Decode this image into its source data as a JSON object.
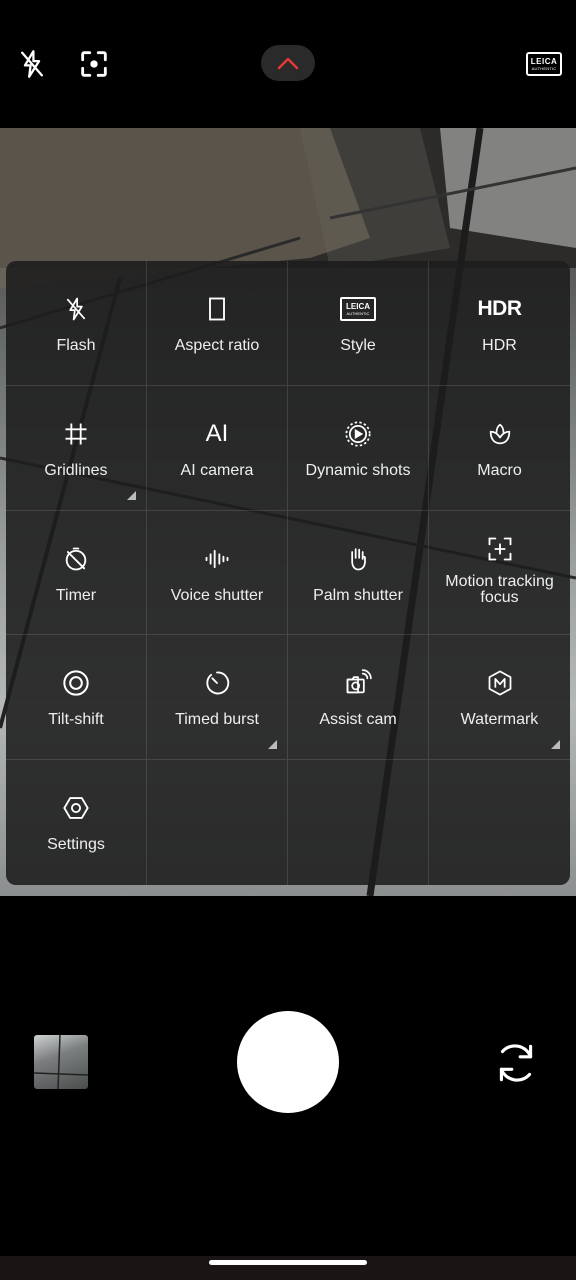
{
  "topbar": {
    "flash_icon": "flash-off-icon",
    "focus_icon": "focus-icon",
    "collapse_icon": "chevron-up-icon",
    "leica_line1": "LEICA",
    "leica_line2": "AUTHENTIC"
  },
  "panel": {
    "items": [
      {
        "label": "Flash",
        "icon": "flash-off-icon"
      },
      {
        "label": "Aspect ratio",
        "icon": "aspect-ratio-icon"
      },
      {
        "label": "Style",
        "icon": "leica-style-icon",
        "icon_text_1": "LEICA",
        "icon_text_2": "AUTHENTIC"
      },
      {
        "label": "HDR",
        "icon": "hdr-icon",
        "icon_text": "HDR"
      },
      {
        "label": "Gridlines",
        "icon": "grid-icon",
        "has_submenu": true
      },
      {
        "label": "AI camera",
        "icon": "ai-icon",
        "icon_text": "AI"
      },
      {
        "label": "Dynamic shots",
        "icon": "dynamic-shots-icon"
      },
      {
        "label": "Macro",
        "icon": "macro-icon"
      },
      {
        "label": "Timer",
        "icon": "timer-off-icon"
      },
      {
        "label": "Voice shutter",
        "icon": "voice-icon"
      },
      {
        "label": "Palm shutter",
        "icon": "palm-icon"
      },
      {
        "label": "Motion tracking focus",
        "icon": "tracking-focus-icon"
      },
      {
        "label": "Tilt-shift",
        "icon": "tilt-shift-icon"
      },
      {
        "label": "Timed burst",
        "icon": "timed-burst-icon",
        "has_submenu": true
      },
      {
        "label": "Assist cam",
        "icon": "assist-cam-icon"
      },
      {
        "label": "Watermark",
        "icon": "watermark-icon",
        "has_submenu": true
      },
      {
        "label": "Settings",
        "icon": "settings-icon"
      }
    ]
  },
  "bottom": {
    "thumbnail": "gallery-thumbnail",
    "shutter": "shutter-button",
    "switch": "switch-camera-icon"
  },
  "colors": {
    "accent_red": "#e53935",
    "panel_bg": "#1c1c1c"
  }
}
